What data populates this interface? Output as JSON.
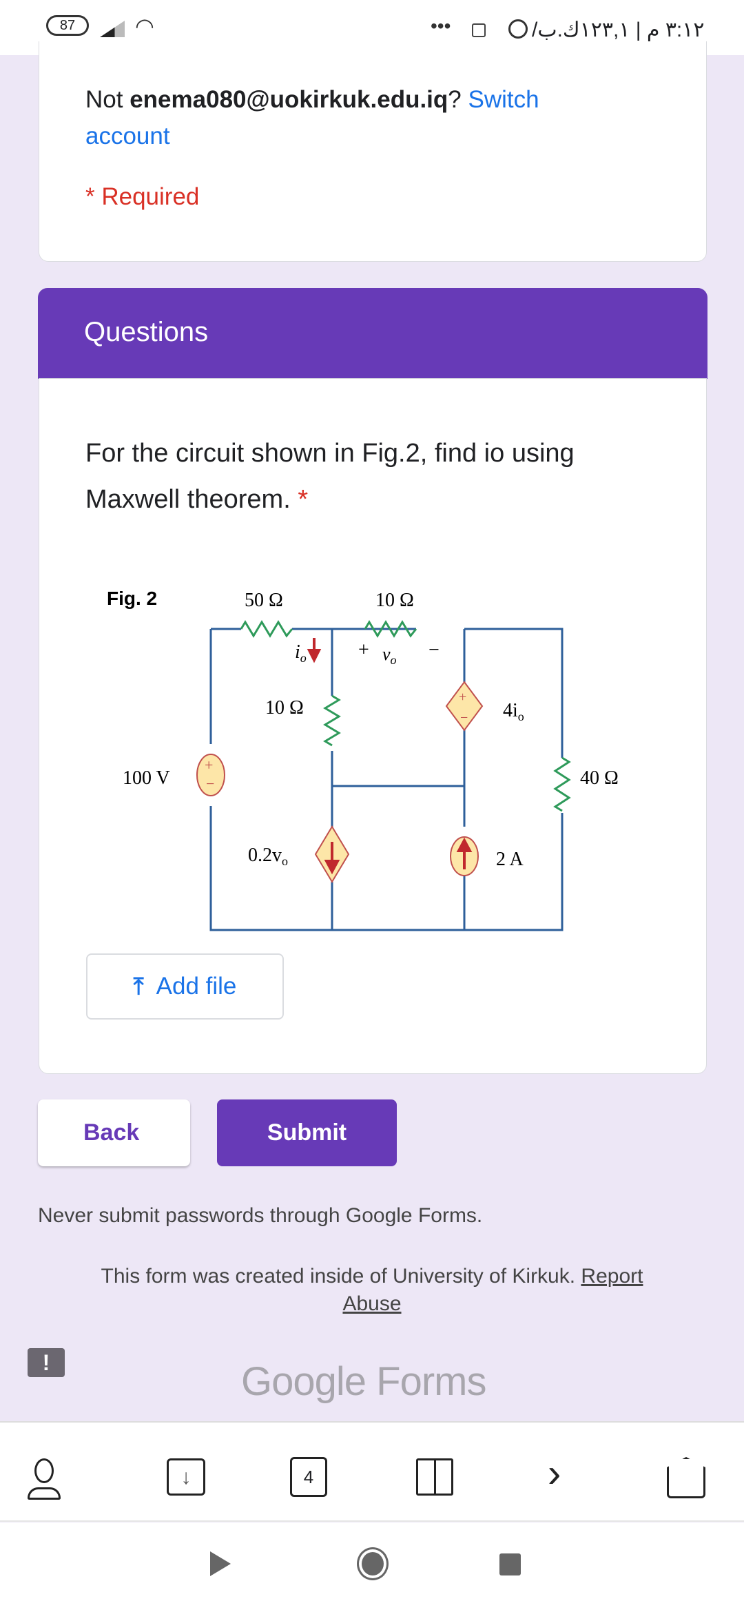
{
  "status_bar": {
    "battery": "87",
    "time_text": "٣:١٢ م | ١٢٣,١ك.ب/ث"
  },
  "account": {
    "prefix": "Not ",
    "email": "enema080@uokirkuk.edu.iq",
    "suffix": "? ",
    "switch_label": "Switch",
    "switch_label_2": "account",
    "required": "* Required"
  },
  "section": {
    "title": "Questions"
  },
  "question": {
    "text_line1": "For the circuit shown in Fig.2, find io using",
    "text_line2": "Maxwell theorem.",
    "required_mark": "*"
  },
  "figure": {
    "label": "Fig. 2",
    "r1": "50 Ω",
    "r2": "10 Ω",
    "r3": "10 Ω",
    "r4": "40 Ω",
    "vsrc": "100 V",
    "dep_v": "4i",
    "dep_v_sub": "o",
    "dep_i": "0.2v",
    "dep_i_sub": "o",
    "isrc": "2 A",
    "io": "i",
    "io_sub": "o",
    "vo": "v",
    "vo_sub": "o",
    "plus": "+",
    "minus": "−"
  },
  "add_file_label": "Add file",
  "nav": {
    "back": "Back",
    "submit": "Submit"
  },
  "footer": {
    "warning": "Never submit passwords through Google Forms.",
    "created": "This form was created inside of University of Kirkuk. ",
    "report": "Report",
    "abuse": "Abuse",
    "logo": "Google Forms"
  },
  "browser_toolbar": {
    "tabs_count": "4"
  },
  "colors": {
    "accent": "#673ab7",
    "link": "#1a73e8",
    "required": "#d93025",
    "background": "#ede7f6"
  }
}
